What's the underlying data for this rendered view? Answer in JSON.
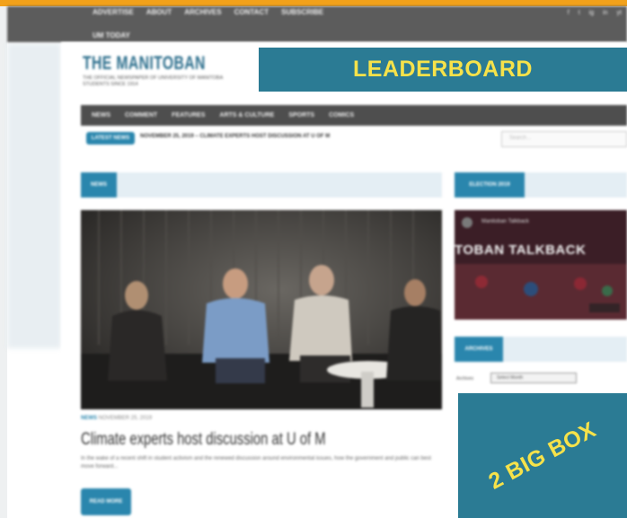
{
  "site": {
    "top_nav": [
      "ADVERTISE",
      "ABOUT",
      "ARCHIVES",
      "CONTACT",
      "SUBSCRIBE"
    ],
    "top_nav_row2": "UM TODAY",
    "socials": [
      "f",
      "t",
      "ig",
      "in",
      "yt"
    ],
    "logo": "THE MANITOBAN",
    "tagline": "THE OFFICIAL NEWSPAPER OF UNIVERSITY OF MANITOBA STUDENTS SINCE 1914",
    "main_nav": [
      "NEWS",
      "COMMENT",
      "FEATURES",
      "ARTS & CULTURE",
      "SPORTS",
      "COMICS"
    ],
    "ticker_label": "LATEST NEWS",
    "ticker_text": "NOVEMBER 25, 2019 – CLIMATE EXPERTS HOST DISCUSSION AT U OF M",
    "search_placeholder": "Search...",
    "section_label": "NEWS",
    "sidebar_label_1": "ELECTION 2019",
    "video_channel": "Manitoban Talkback",
    "video_title": "TOBAN TALKBACK",
    "sidebar_label_2": "ARCHIVES",
    "archive_label": "Archives",
    "archive_select": "Select Month",
    "article": {
      "category": "NEWS",
      "date": "NOVEMBER 25, 2019",
      "headline": "Climate experts host discussion at U of M",
      "excerpt": "In the wake of a recent shift in student activism and the renewed discussion around environmental issues, how the government and public can best move forward...",
      "read_more": "READ MORE"
    }
  },
  "overlays": {
    "leaderboard": "LEADERBOARD",
    "big_box": "2 BIG BOX"
  },
  "colors": {
    "accent": "#2a86ad",
    "overlay_bg": "#2b7b94",
    "overlay_text": "#f6e24a",
    "top_bar": "#f2a11a"
  }
}
